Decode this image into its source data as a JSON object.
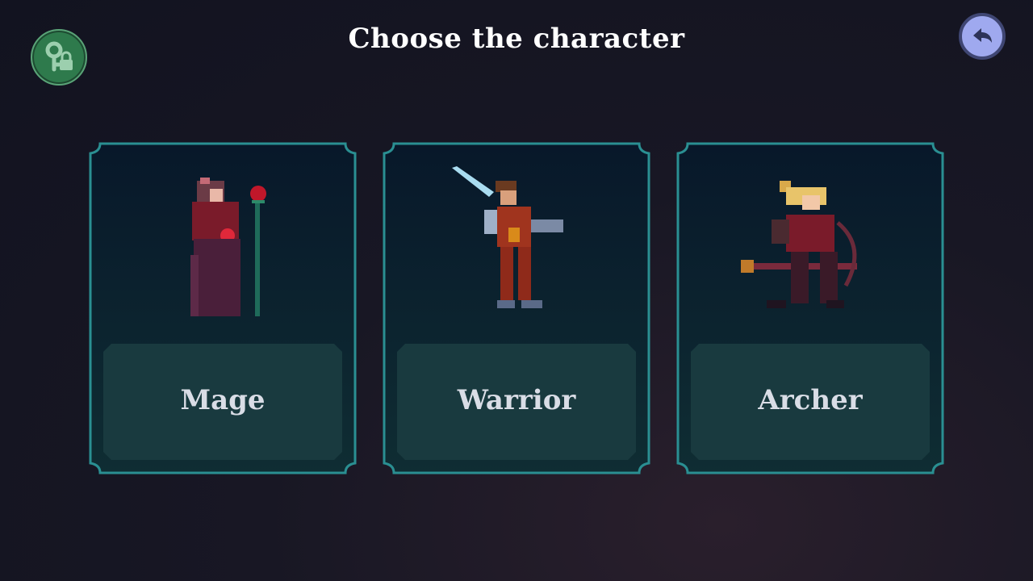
{
  "screen": {
    "title": "Choose the character"
  },
  "buttons": {
    "unlock_icon": "key-lock-icon",
    "back_icon": "undo-arrow-icon"
  },
  "characters": [
    {
      "id": "mage",
      "name": "Mage"
    },
    {
      "id": "warrior",
      "name": "Warrior"
    },
    {
      "id": "archer",
      "name": "Archer"
    }
  ],
  "colors": {
    "card_border": "#2a8f92",
    "card_fill_top": "#091a26",
    "card_fill_bottom": "#0d2a31",
    "label_box": "#193a3f",
    "unlock_button": "#2e7a4c",
    "back_button": "#9fa9ef"
  }
}
